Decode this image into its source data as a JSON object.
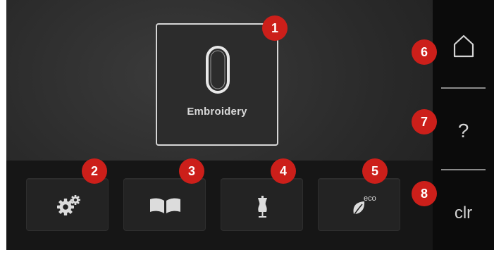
{
  "embroidery_tile": {
    "label": "Embroidery",
    "icon": "embroidery-hoop-icon"
  },
  "toolbar": {
    "buttons": [
      {
        "name": "setup",
        "icon": "gears-icon"
      },
      {
        "name": "tutorial",
        "icon": "book-icon"
      },
      {
        "name": "consultant",
        "icon": "dress-form-icon"
      },
      {
        "name": "eco-mode",
        "icon": "eco-leaf-icon",
        "eco_label": "eco"
      }
    ]
  },
  "sidebar": {
    "home_icon": "home-icon",
    "help_label": "?",
    "clear_label": "clr"
  },
  "callouts": [
    "1",
    "2",
    "3",
    "4",
    "5",
    "6",
    "7",
    "8"
  ],
  "colors": {
    "callout": "#cc1f1a",
    "screen_background": "#2a2a2a",
    "sidebar_background": "#0b0b0b",
    "icon": "#dcdcdc"
  }
}
